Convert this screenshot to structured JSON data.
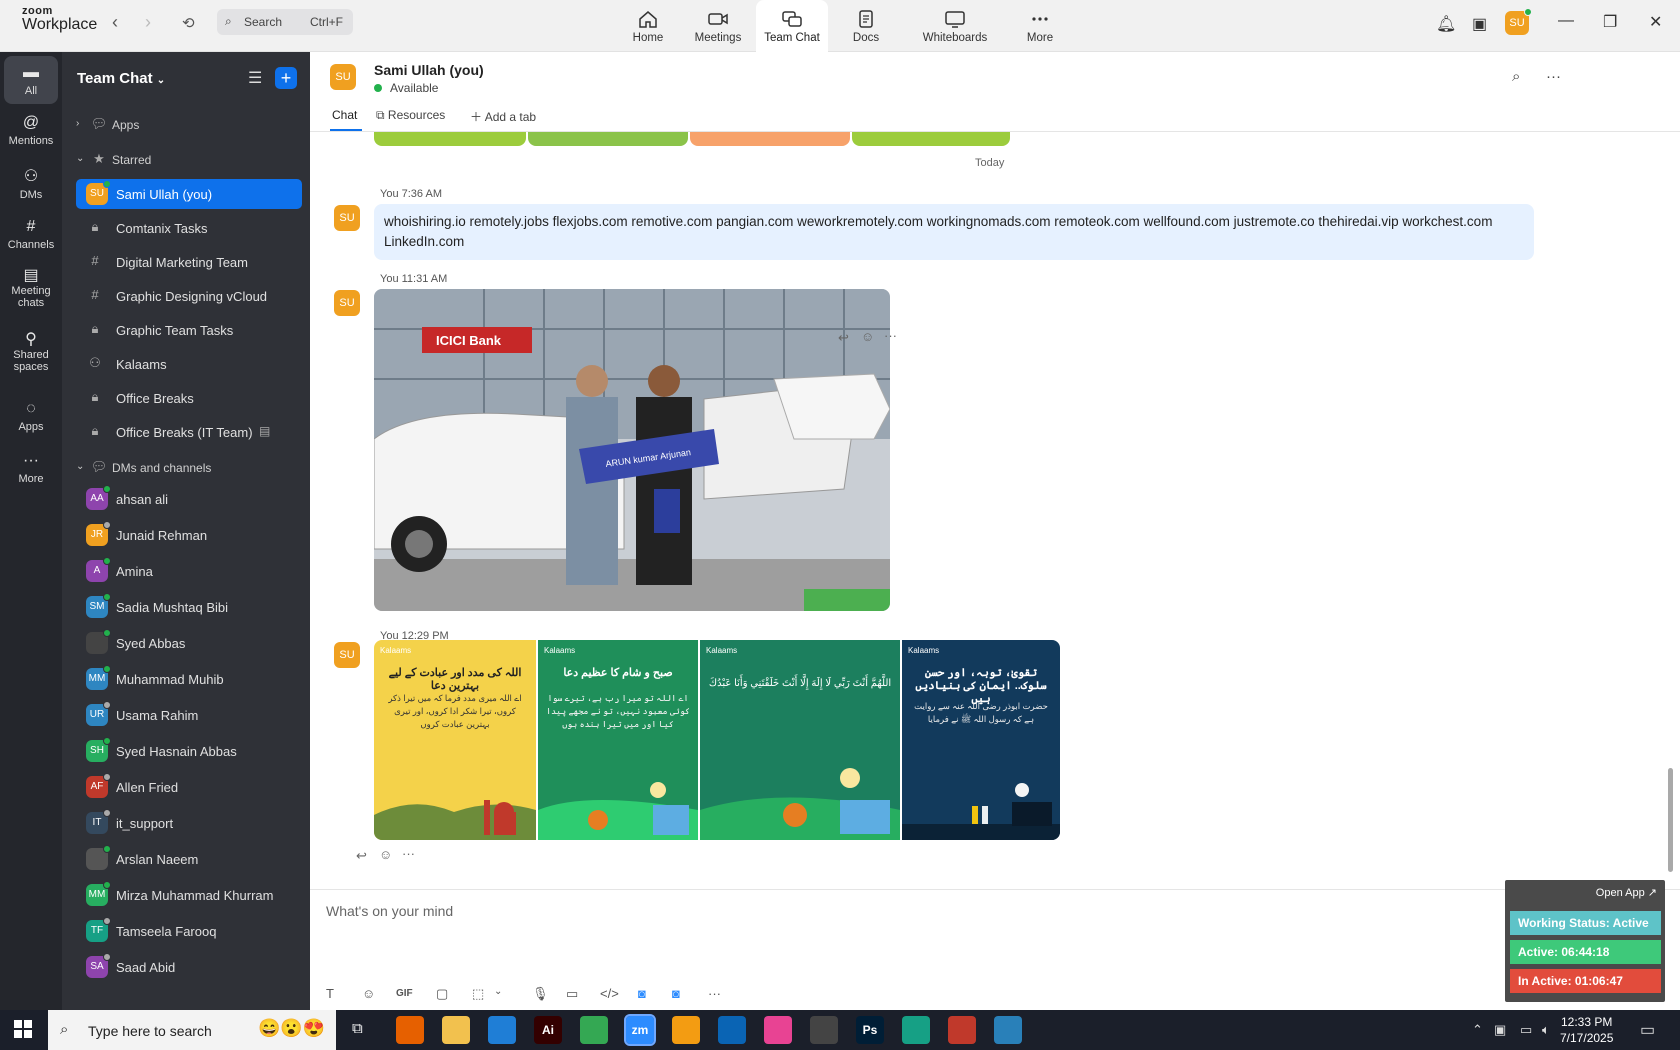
{
  "app": {
    "brand_top": "zoom",
    "brand_bottom": "Workplace"
  },
  "search": {
    "label": "Search",
    "shortcut": "Ctrl+F"
  },
  "tabs": [
    {
      "label": "Home",
      "icon": "home-icon"
    },
    {
      "label": "Meetings",
      "icon": "video-icon"
    },
    {
      "label": "Team Chat",
      "icon": "chat-icon"
    },
    {
      "label": "Docs",
      "icon": "doc-icon"
    },
    {
      "label": "Whiteboards",
      "icon": "whiteboard-icon"
    },
    {
      "label": "More",
      "icon": "more-icon"
    }
  ],
  "user_avatar": "SU",
  "rail": [
    {
      "label": "All"
    },
    {
      "label": "Mentions"
    },
    {
      "label": "DMs"
    },
    {
      "label": "Channels"
    },
    {
      "label": "Meeting chats"
    },
    {
      "label": "Shared spaces"
    },
    {
      "label": "Apps"
    },
    {
      "label": "More"
    }
  ],
  "sidebar": {
    "title": "Team Chat",
    "apps_label": "Apps",
    "starred_label": "Starred",
    "starred": [
      {
        "label": "Sami Ullah (you)",
        "avatar": "SU"
      },
      {
        "label": "Comtanix Tasks",
        "icon": "lock-icon"
      },
      {
        "label": "Digital Marketing Team",
        "icon": "hash-icon"
      },
      {
        "label": "Graphic Designing vCloud",
        "icon": "hash-icon"
      },
      {
        "label": "Graphic Team Tasks",
        "icon": "lock-icon"
      },
      {
        "label": "Kalaams",
        "icon": "group-icon"
      },
      {
        "label": "Office Breaks",
        "icon": "lock-icon"
      },
      {
        "label": "Office Breaks (IT Team)",
        "icon": "lock-icon"
      }
    ],
    "dms_label": "DMs and channels",
    "dms": [
      {
        "label": "ahsan ali",
        "avatar": "AA",
        "color": "#8e44ad",
        "status": "#22b14c"
      },
      {
        "label": "Junaid Rehman",
        "avatar": "JR",
        "color": "#f0a020",
        "status": "#aaaaaa"
      },
      {
        "label": "Amina",
        "avatar": "A",
        "color": "#8e44ad",
        "status": "#22b14c"
      },
      {
        "label": "Sadia Mushtaq Bibi",
        "avatar": "SM",
        "color": "#2e86c1",
        "status": "#22b14c"
      },
      {
        "label": "Syed Abbas",
        "avatar": "",
        "color": "#444",
        "status": "#22b14c"
      },
      {
        "label": "Muhammad Muhib",
        "avatar": "MM",
        "color": "#2e86c1",
        "status": "#22b14c"
      },
      {
        "label": "Usama Rahim",
        "avatar": "UR",
        "color": "#2e86c1",
        "status": "#aaaaaa"
      },
      {
        "label": "Syed Hasnain Abbas",
        "avatar": "SH",
        "color": "#27ae60",
        "status": "#22b14c"
      },
      {
        "label": "Allen Fried",
        "avatar": "AF",
        "color": "#c0392b",
        "status": "#aaaaaa"
      },
      {
        "label": "it_support",
        "avatar": "IT",
        "color": "#34495e",
        "status": "#aaaaaa"
      },
      {
        "label": "Arslan Naeem",
        "avatar": "",
        "color": "#555",
        "status": "#22b14c"
      },
      {
        "label": "Mirza Muhammad Khurram",
        "avatar": "MM",
        "color": "#27ae60",
        "status": "#22b14c"
      },
      {
        "label": "Tamseela Farooq",
        "avatar": "TF",
        "color": "#16a085",
        "status": "#aaaaaa"
      },
      {
        "label": "Saad Abid",
        "avatar": "SA",
        "color": "#8e44ad",
        "status": "#aaaaaa"
      }
    ]
  },
  "channel": {
    "avatar": "SU",
    "name": "Sami Ullah (you)",
    "status": "Available",
    "tabs": [
      "Chat",
      "Resources",
      "Add a tab"
    ]
  },
  "messages": {
    "today": "Today",
    "m1": {
      "meta": "You 7:36 AM",
      "avatar": "SU",
      "text": "whoishiring.io remotely.jobs flexjobs.com remotive.com pangian.com weworkremotely.com workingnomads.com remoteok.com wellfound.com justremote.co thehiredai.vip workchest.com LinkedIn.com"
    },
    "m2": {
      "meta": "You 11:31 AM",
      "avatar": "SU",
      "photo_sign": "ICICI Bank",
      "photo_banner": "ARUN kumar Arjunan"
    },
    "m3": {
      "meta": "You 12:29 PM",
      "avatar": "SU",
      "posters": [
        {
          "brand": "Kalaams",
          "title": "اللہ کی مدد اور عبادت کے لیے بہترین دعا",
          "body": "اے اللہ میری مدد فرما کہ میں تیرا ذکر کروں، تیرا شکر ادا کروں، اور تیری بہترین عبادت کروں",
          "bg": "#f4d24a"
        },
        {
          "brand": "Kalaams",
          "title": "صبح و شام کا عظیم دعا",
          "body": "اے اللہ تو میرا رب ہے، تیرے سوا کوئی معبود نہیں، تو نے مجھے پیدا کیا اور میں تیرا بندہ ہوں",
          "bg": "#1f8f5a"
        },
        {
          "brand": "Kalaams",
          "title": "",
          "body": "اللَّهُمَّ أَنْتَ رَبِّي لَا إِلَهَ إِلَّا أَنْتَ خَلَقْتَنِي وَأَنَا عَبْدُكَ",
          "bg": "#1c7f5e"
        },
        {
          "brand": "Kalaams",
          "title": "تقویٰ، توبہ، اور حسن سلوک.. ایمان کی بنیادیں ہیں",
          "body": "حضرت ابوذر رضی اللہ عنہ سے روایت ہے کہ رسول اللہ ﷺ نے فرمایا",
          "bg": "#123a5c"
        }
      ]
    }
  },
  "composer": {
    "placeholder": "What's on your mind",
    "gif": "GIF"
  },
  "widget": {
    "open": "Open App ↗",
    "status": "Working Status: Active",
    "active": "Active: 06:44:18",
    "inactive": "In Active: 01:06:47"
  },
  "taskbar": {
    "search": "Type here to search",
    "time": "12:33 PM",
    "date": "7/17/2025",
    "apps": [
      {
        "name": "firefox",
        "label": "",
        "color": "#e66000"
      },
      {
        "name": "files",
        "label": "",
        "color": "#f2c14e"
      },
      {
        "name": "vscode",
        "label": "",
        "color": "#1f7ed6"
      },
      {
        "name": "illustrator",
        "label": "Ai",
        "color": "#330000"
      },
      {
        "name": "chrome",
        "label": "",
        "color": "#34a853"
      },
      {
        "name": "zoom",
        "label": "zm",
        "color": "#2d8cff"
      },
      {
        "name": "app7",
        "label": "",
        "color": "#f39c12"
      },
      {
        "name": "outlook",
        "label": "",
        "color": "#0a64b4"
      },
      {
        "name": "app9",
        "label": "",
        "color": "#e84393"
      },
      {
        "name": "app10",
        "label": "",
        "color": "#444"
      },
      {
        "name": "photoshop",
        "label": "Ps",
        "color": "#001e36"
      },
      {
        "name": "app12",
        "label": "",
        "color": "#16a085"
      },
      {
        "name": "app13",
        "label": "",
        "color": "#c0392b"
      },
      {
        "name": "app14",
        "label": "",
        "color": "#2980b9"
      }
    ]
  }
}
